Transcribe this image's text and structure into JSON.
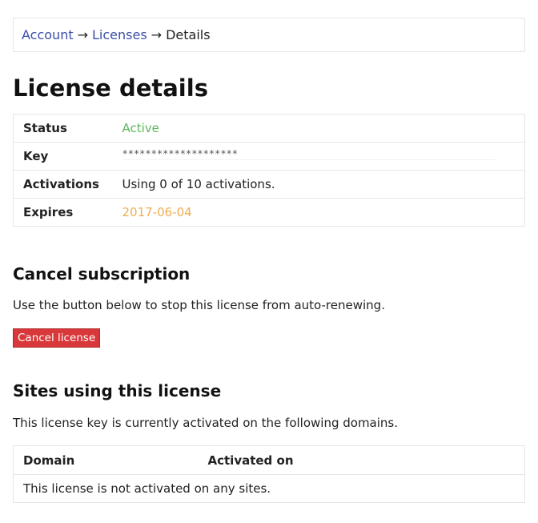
{
  "breadcrumb": {
    "account": "Account",
    "licenses": "Licenses",
    "separator": "→",
    "current": "Details"
  },
  "page_title": "License details",
  "details": {
    "status_label": "Status",
    "status_value": "Active",
    "key_label": "Key",
    "key_value": "********************",
    "activations_label": "Activations",
    "activations_value": "Using 0 of 10 activations.",
    "expires_label": "Expires",
    "expires_value": "2017-06-04"
  },
  "cancel_section": {
    "heading": "Cancel subscription",
    "description": "Use the button below to stop this license from auto-renewing.",
    "button_label": "Cancel license"
  },
  "sites_section": {
    "heading": "Sites using this license",
    "description": "This license key is currently activated on the following domains.",
    "columns": [
      "Domain",
      "Activated on"
    ],
    "empty_message": "This license is not activated on any sites."
  },
  "colors": {
    "link": "#3b4fa8",
    "status_active": "#5cb85c",
    "expires": "#f0ad4e",
    "danger_button": "#d9383a"
  }
}
